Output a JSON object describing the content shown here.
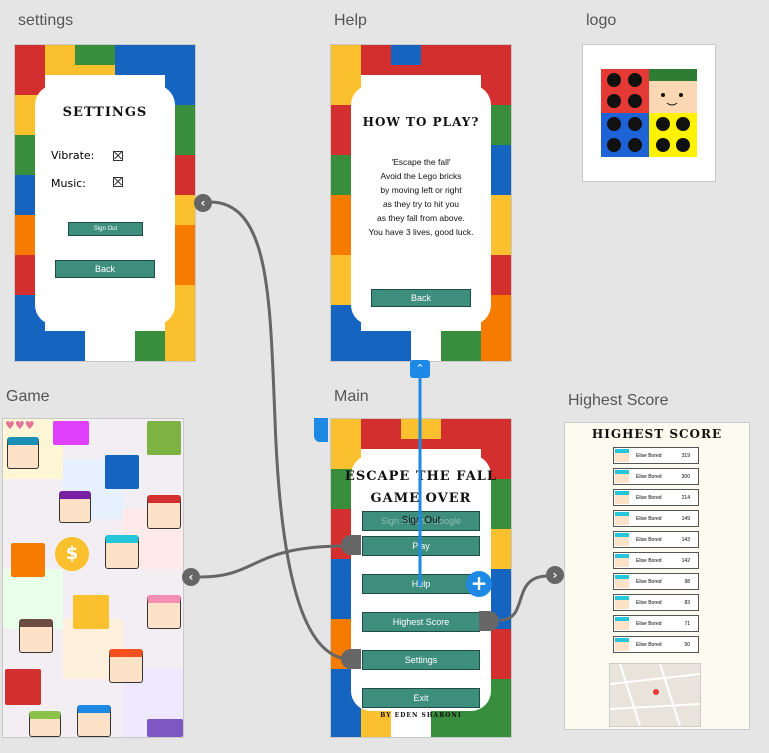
{
  "artboards": {
    "settings": {
      "label": "settings",
      "title": "SETTINGS",
      "vibrate_label": "Vibrate:",
      "music_label": "Music:",
      "signout_label": "Sign Out",
      "back_label": "Back"
    },
    "help": {
      "label": "Help",
      "title": "HOW TO PLAY?",
      "lines": [
        "'Escape the fall'",
        "Avoid the Lego bricks",
        "by moving left or right",
        "as they try to hit you",
        "as they fall from above.",
        "You have 3 lives, good luck."
      ],
      "back_label": "Back"
    },
    "logo": {
      "label": "logo"
    },
    "game": {
      "label": "Game",
      "lives": "♥♥♥"
    },
    "main": {
      "label": "Main",
      "title1": "ESCAPE THE FALL",
      "title2": "GAME OVER",
      "signin_label": "Sign In With Google",
      "signout_label": "Sign Out",
      "play_label": "Play",
      "help_label": "Help",
      "highscore_label": "Highest Score",
      "settings_label": "Settings",
      "exit_label": "Exit",
      "credit": "BY EDEN SHARONI"
    },
    "highscore": {
      "label": "Highest Score",
      "title": "HIGHEST SCORE",
      "rows": [
        {
          "name": "Elise Bored",
          "score": "319"
        },
        {
          "name": "Elise Bored",
          "score": "300"
        },
        {
          "name": "Elise Bored",
          "score": "214"
        },
        {
          "name": "Elise Bored",
          "score": "149"
        },
        {
          "name": "Elise Bored",
          "score": "143"
        },
        {
          "name": "Elise Bored",
          "score": "142"
        },
        {
          "name": "Elise Bored",
          "score": "98"
        },
        {
          "name": "Elise Bored",
          "score": "83"
        },
        {
          "name": "Elise Bored",
          "score": "71"
        },
        {
          "name": "Elise Bored",
          "score": "50"
        }
      ]
    }
  },
  "colors": {
    "accent": "#1e88e5",
    "button": "#3e8e7e",
    "connector": "#666666",
    "lego_red": "#d32f2f",
    "lego_yellow": "#fbc02d",
    "lego_blue": "#1565c0",
    "lego_green": "#388e3c",
    "lego_orange": "#f57c00"
  },
  "icons": {
    "back_arrow": "chevron-left-icon",
    "forward_arrow": "chevron-right-icon",
    "up_arrow": "chevron-up-icon",
    "add": "plus-icon",
    "heart": "heart-icon"
  }
}
